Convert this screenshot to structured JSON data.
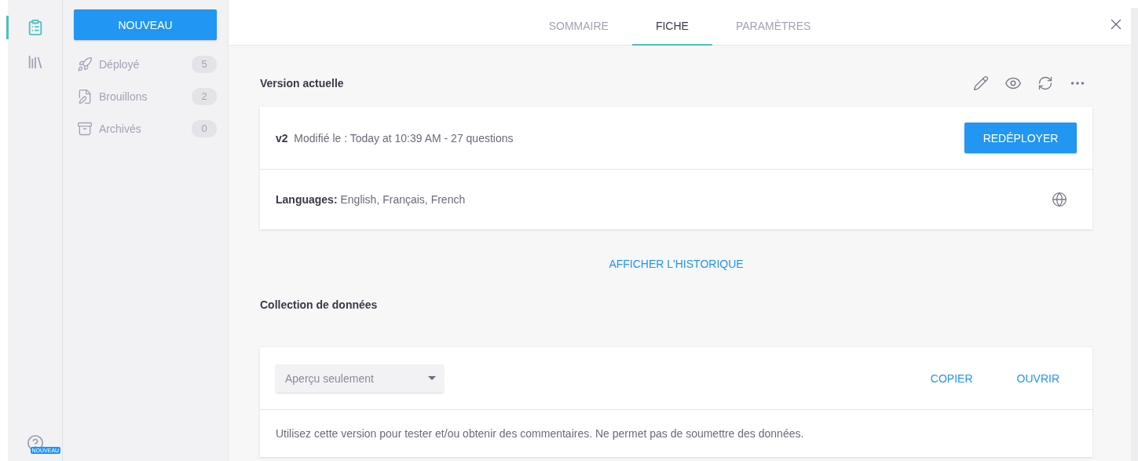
{
  "rail": {
    "items": [
      {
        "kind": "forms",
        "selected": true
      },
      {
        "kind": "library",
        "selected": false
      }
    ],
    "help_badge": "NOUVEAU"
  },
  "sidebar": {
    "new_button": "NOUVEAU",
    "items": [
      {
        "kind": "deployed",
        "label": "Déployé",
        "count": "5"
      },
      {
        "kind": "drafts",
        "label": "Brouillons",
        "count": "2"
      },
      {
        "kind": "archived",
        "label": "Archivés",
        "count": "0"
      }
    ]
  },
  "tabs": [
    {
      "label": "SOMMAIRE",
      "selected": false
    },
    {
      "label": "FICHE",
      "selected": true
    },
    {
      "label": "PARAMÈTRES",
      "selected": false
    }
  ],
  "current_version": {
    "title": "Version actuelle",
    "version": "v2",
    "modified": "Modifié le : Today at 10:39 AM - 27 questions",
    "redeploy_button": "REDÉPLOYER",
    "languages_label": "Languages:",
    "languages": "English, Français, French"
  },
  "history_link": "AFFICHER L'HISTORIQUE",
  "data_collection": {
    "title": "Collection de données",
    "select": "Aperçu seulement",
    "copy_button": "COPIER",
    "open_button": "OUVRIR",
    "description": "Utilisez cette version pour tester et/ou obtenir des commentaires. Ne permet pas de soumettre des données."
  }
}
